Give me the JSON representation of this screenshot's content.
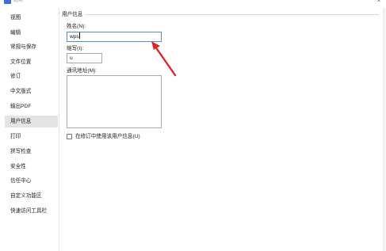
{
  "window": {
    "title": "选项",
    "close_glyph": "×"
  },
  "sidebar": {
    "items": [
      {
        "label": "视图"
      },
      {
        "label": "编辑"
      },
      {
        "label": "常规与保存"
      },
      {
        "label": "文件位置"
      },
      {
        "label": "修订"
      },
      {
        "label": "中文版式"
      },
      {
        "label": "输出PDF"
      },
      {
        "label": "用户信息",
        "selected": true
      },
      {
        "label": "打印"
      },
      {
        "label": "拼写检查"
      },
      {
        "label": "安全性"
      },
      {
        "label": "信任中心"
      },
      {
        "label": "自定义功能区"
      },
      {
        "label": "快速访问工具栏"
      }
    ]
  },
  "user_info": {
    "group_title": "用户信息",
    "name_label": "姓名(N):",
    "name_value": "wps",
    "initials_label": "缩写(I):",
    "initials_value": "u",
    "address_label": "通讯地址(M):",
    "address_value": "",
    "checkbox_label": "在修订中使用该用户信息(U)",
    "checkbox_checked": false
  },
  "annotation": {
    "arrow_color": "#e0242c"
  }
}
